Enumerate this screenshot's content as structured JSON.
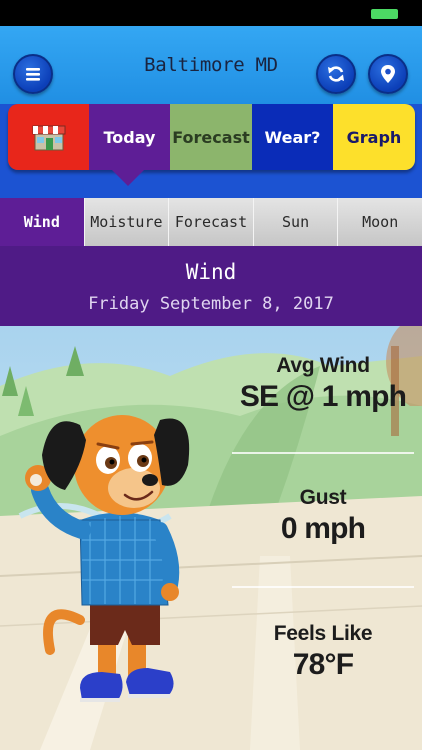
{
  "header": {
    "city": "Baltimore MD"
  },
  "icons": {
    "menu": "hamburger-menu-icon",
    "refresh": "refresh-icon",
    "location": "map-pin-icon",
    "home": "storefront-icon"
  },
  "main_tabs": {
    "today": "Today",
    "forecast": "Forecast",
    "wear": "Wear?",
    "graph": "Graph"
  },
  "sub_tabs": {
    "wind": "Wind",
    "moisture": "Moisture",
    "forecast": "Forecast",
    "sun": "Sun",
    "moon": "Moon"
  },
  "section": {
    "title": "Wind",
    "date": "Friday September 8, 2017"
  },
  "stats": {
    "avg_wind_label": "Avg Wind",
    "avg_wind_value": "SE @ 1 mph",
    "gust_label": "Gust",
    "gust_value": "0 mph",
    "feels_like_label": "Feels Like",
    "feels_like_value": "78°F"
  },
  "colors": {
    "nav_blue": "#1f8de2",
    "today_purple": "#5e1e96",
    "forecast_green": "#8cb56c",
    "wear_blue": "#0a2cb8",
    "graph_yellow": "#fde02b",
    "home_red": "#e8261b"
  }
}
